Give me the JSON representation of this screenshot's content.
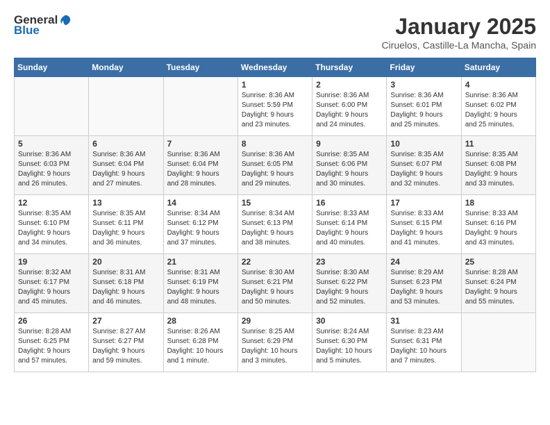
{
  "header": {
    "logo_general": "General",
    "logo_blue": "Blue",
    "calendar_title": "January 2025",
    "calendar_subtitle": "Ciruelos, Castille-La Mancha, Spain"
  },
  "days_of_week": [
    "Sunday",
    "Monday",
    "Tuesday",
    "Wednesday",
    "Thursday",
    "Friday",
    "Saturday"
  ],
  "weeks": [
    [
      {
        "day": "",
        "info": ""
      },
      {
        "day": "",
        "info": ""
      },
      {
        "day": "",
        "info": ""
      },
      {
        "day": "1",
        "info": "Sunrise: 8:36 AM\nSunset: 5:59 PM\nDaylight: 9 hours\nand 23 minutes."
      },
      {
        "day": "2",
        "info": "Sunrise: 8:36 AM\nSunset: 6:00 PM\nDaylight: 9 hours\nand 24 minutes."
      },
      {
        "day": "3",
        "info": "Sunrise: 8:36 AM\nSunset: 6:01 PM\nDaylight: 9 hours\nand 25 minutes."
      },
      {
        "day": "4",
        "info": "Sunrise: 8:36 AM\nSunset: 6:02 PM\nDaylight: 9 hours\nand 25 minutes."
      }
    ],
    [
      {
        "day": "5",
        "info": "Sunrise: 8:36 AM\nSunset: 6:03 PM\nDaylight: 9 hours\nand 26 minutes."
      },
      {
        "day": "6",
        "info": "Sunrise: 8:36 AM\nSunset: 6:04 PM\nDaylight: 9 hours\nand 27 minutes."
      },
      {
        "day": "7",
        "info": "Sunrise: 8:36 AM\nSunset: 6:04 PM\nDaylight: 9 hours\nand 28 minutes."
      },
      {
        "day": "8",
        "info": "Sunrise: 8:36 AM\nSunset: 6:05 PM\nDaylight: 9 hours\nand 29 minutes."
      },
      {
        "day": "9",
        "info": "Sunrise: 8:35 AM\nSunset: 6:06 PM\nDaylight: 9 hours\nand 30 minutes."
      },
      {
        "day": "10",
        "info": "Sunrise: 8:35 AM\nSunset: 6:07 PM\nDaylight: 9 hours\nand 32 minutes."
      },
      {
        "day": "11",
        "info": "Sunrise: 8:35 AM\nSunset: 6:08 PM\nDaylight: 9 hours\nand 33 minutes."
      }
    ],
    [
      {
        "day": "12",
        "info": "Sunrise: 8:35 AM\nSunset: 6:10 PM\nDaylight: 9 hours\nand 34 minutes."
      },
      {
        "day": "13",
        "info": "Sunrise: 8:35 AM\nSunset: 6:11 PM\nDaylight: 9 hours\nand 36 minutes."
      },
      {
        "day": "14",
        "info": "Sunrise: 8:34 AM\nSunset: 6:12 PM\nDaylight: 9 hours\nand 37 minutes."
      },
      {
        "day": "15",
        "info": "Sunrise: 8:34 AM\nSunset: 6:13 PM\nDaylight: 9 hours\nand 38 minutes."
      },
      {
        "day": "16",
        "info": "Sunrise: 8:33 AM\nSunset: 6:14 PM\nDaylight: 9 hours\nand 40 minutes."
      },
      {
        "day": "17",
        "info": "Sunrise: 8:33 AM\nSunset: 6:15 PM\nDaylight: 9 hours\nand 41 minutes."
      },
      {
        "day": "18",
        "info": "Sunrise: 8:33 AM\nSunset: 6:16 PM\nDaylight: 9 hours\nand 43 minutes."
      }
    ],
    [
      {
        "day": "19",
        "info": "Sunrise: 8:32 AM\nSunset: 6:17 PM\nDaylight: 9 hours\nand 45 minutes."
      },
      {
        "day": "20",
        "info": "Sunrise: 8:31 AM\nSunset: 6:18 PM\nDaylight: 9 hours\nand 46 minutes."
      },
      {
        "day": "21",
        "info": "Sunrise: 8:31 AM\nSunset: 6:19 PM\nDaylight: 9 hours\nand 48 minutes."
      },
      {
        "day": "22",
        "info": "Sunrise: 8:30 AM\nSunset: 6:21 PM\nDaylight: 9 hours\nand 50 minutes."
      },
      {
        "day": "23",
        "info": "Sunrise: 8:30 AM\nSunset: 6:22 PM\nDaylight: 9 hours\nand 52 minutes."
      },
      {
        "day": "24",
        "info": "Sunrise: 8:29 AM\nSunset: 6:23 PM\nDaylight: 9 hours\nand 53 minutes."
      },
      {
        "day": "25",
        "info": "Sunrise: 8:28 AM\nSunset: 6:24 PM\nDaylight: 9 hours\nand 55 minutes."
      }
    ],
    [
      {
        "day": "26",
        "info": "Sunrise: 8:28 AM\nSunset: 6:25 PM\nDaylight: 9 hours\nand 57 minutes."
      },
      {
        "day": "27",
        "info": "Sunrise: 8:27 AM\nSunset: 6:27 PM\nDaylight: 9 hours\nand 59 minutes."
      },
      {
        "day": "28",
        "info": "Sunrise: 8:26 AM\nSunset: 6:28 PM\nDaylight: 10 hours\nand 1 minute."
      },
      {
        "day": "29",
        "info": "Sunrise: 8:25 AM\nSunset: 6:29 PM\nDaylight: 10 hours\nand 3 minutes."
      },
      {
        "day": "30",
        "info": "Sunrise: 8:24 AM\nSunset: 6:30 PM\nDaylight: 10 hours\nand 5 minutes."
      },
      {
        "day": "31",
        "info": "Sunrise: 8:23 AM\nSunset: 6:31 PM\nDaylight: 10 hours\nand 7 minutes."
      },
      {
        "day": "",
        "info": ""
      }
    ]
  ]
}
